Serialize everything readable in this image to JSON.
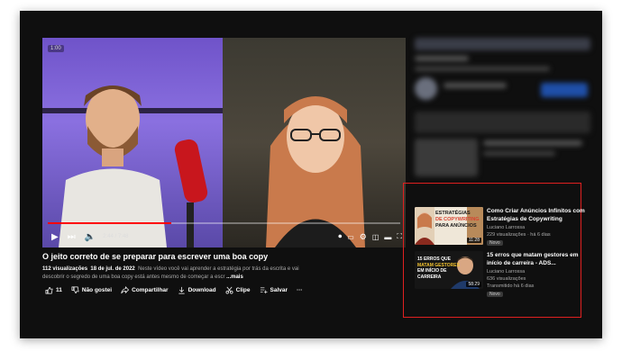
{
  "video": {
    "title": "O jeito correto de se preparar para escrever uma boa copy",
    "badge": "1:00",
    "time": "2:44 / 7:48",
    "progress_fraction": 0.35
  },
  "meta": {
    "views": "112 visualizações",
    "date": "18 de jul. de 2022",
    "description": "Neste vídeo você vai aprender a estratégia por trás da escrita e vai descobrir o segredo de uma boa copy está antes mesmo de começar a escr",
    "more": "...mais"
  },
  "actions": {
    "like_count": "11",
    "dislike": "Não gostei",
    "share": "Compartilhar",
    "download": "Download",
    "clip": "Clipe",
    "save": "Salvar",
    "more": "···"
  },
  "recommendations": [
    {
      "title": "Como Criar Anúncios Infinitos com Estratégias de Copywriting",
      "channel": "Luciano Larrossa",
      "stats": "229 visualizações · há 6 dias",
      "badge": "Novo",
      "duration": "11:28",
      "thumb_text": [
        "ESTRATÉGIAS",
        "DE COPYWRITING",
        "PARA ANÚNCIOS"
      ]
    },
    {
      "title": "15 erros que matam gestores em início de carreira - ADS...",
      "channel": "Luciano Larrossa",
      "stats": "636 visualizações",
      "stats2": "Transmitido há 6 dias",
      "badge": "Novo",
      "duration": "58:29",
      "thumb_text": [
        "15 ERROS QUE",
        "MATAM GESTORES",
        "EM INÍCIO DE",
        "CARREIRA"
      ]
    }
  ],
  "colors": {
    "accent": "#ff0000",
    "highlight_box": "#e02020",
    "background": "#0f0f0f"
  }
}
